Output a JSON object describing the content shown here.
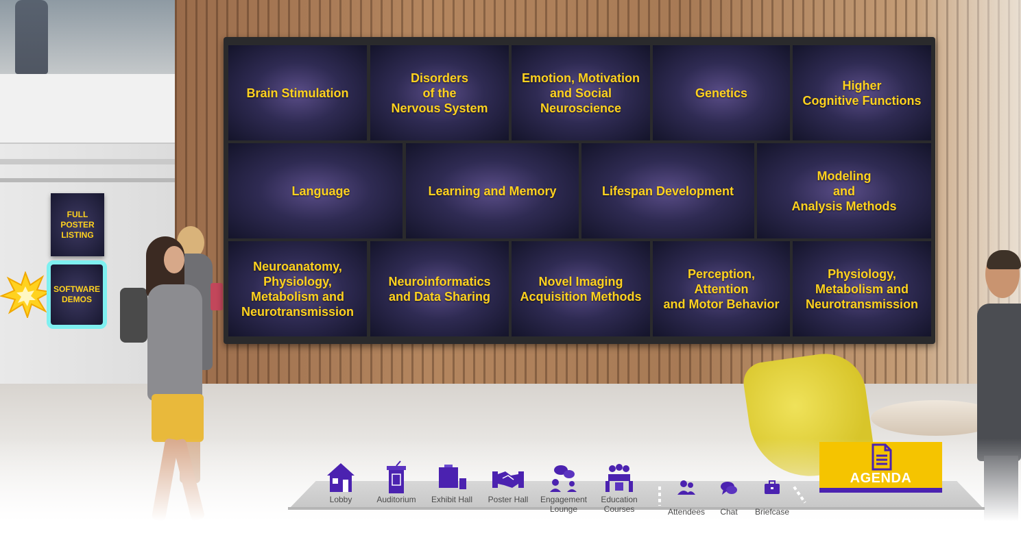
{
  "video_wall": {
    "row1": [
      "Brain Stimulation",
      "Disorders\nof the\nNervous System",
      "Emotion, Motivation\nand Social\nNeuroscience",
      "Genetics",
      "Higher\nCognitive Functions"
    ],
    "row2": [
      "Language",
      "Learning and Memory",
      "Lifespan Development",
      "Modeling\nand\nAnalysis Methods"
    ],
    "row3": [
      "Neuroanatomy,\nPhysiology,\nMetabolism and\nNeurotransmission",
      "Neuroinformatics\nand Data Sharing",
      "Novel Imaging\nAcquisition Methods",
      "Perception,\nAttention\nand Motor Behavior",
      "Physiology,\nMetabolism and\nNeurotransmission"
    ]
  },
  "side_buttons": {
    "full_poster_listing": "FULL\nPOSTER\nLISTING",
    "software_demos": "SOFTWARE\nDEMOS"
  },
  "nav": {
    "lobby": "Lobby",
    "auditorium": "Auditorium",
    "exhibit_hall": "Exhibit Hall",
    "poster_hall": "Poster Hall",
    "engagement_lounge": "Engagement\nLounge",
    "education_courses": "Education\nCourses",
    "attendees": "Attendees",
    "chat": "Chat",
    "briefcase": "Briefcase"
  },
  "agenda": {
    "label": "AGENDA"
  },
  "colors": {
    "accent_yellow": "#ffd21f",
    "nav_purple": "#4b22b0",
    "agenda_yellow": "#f5c400",
    "highlight_cyan": "#7ff0f0"
  }
}
